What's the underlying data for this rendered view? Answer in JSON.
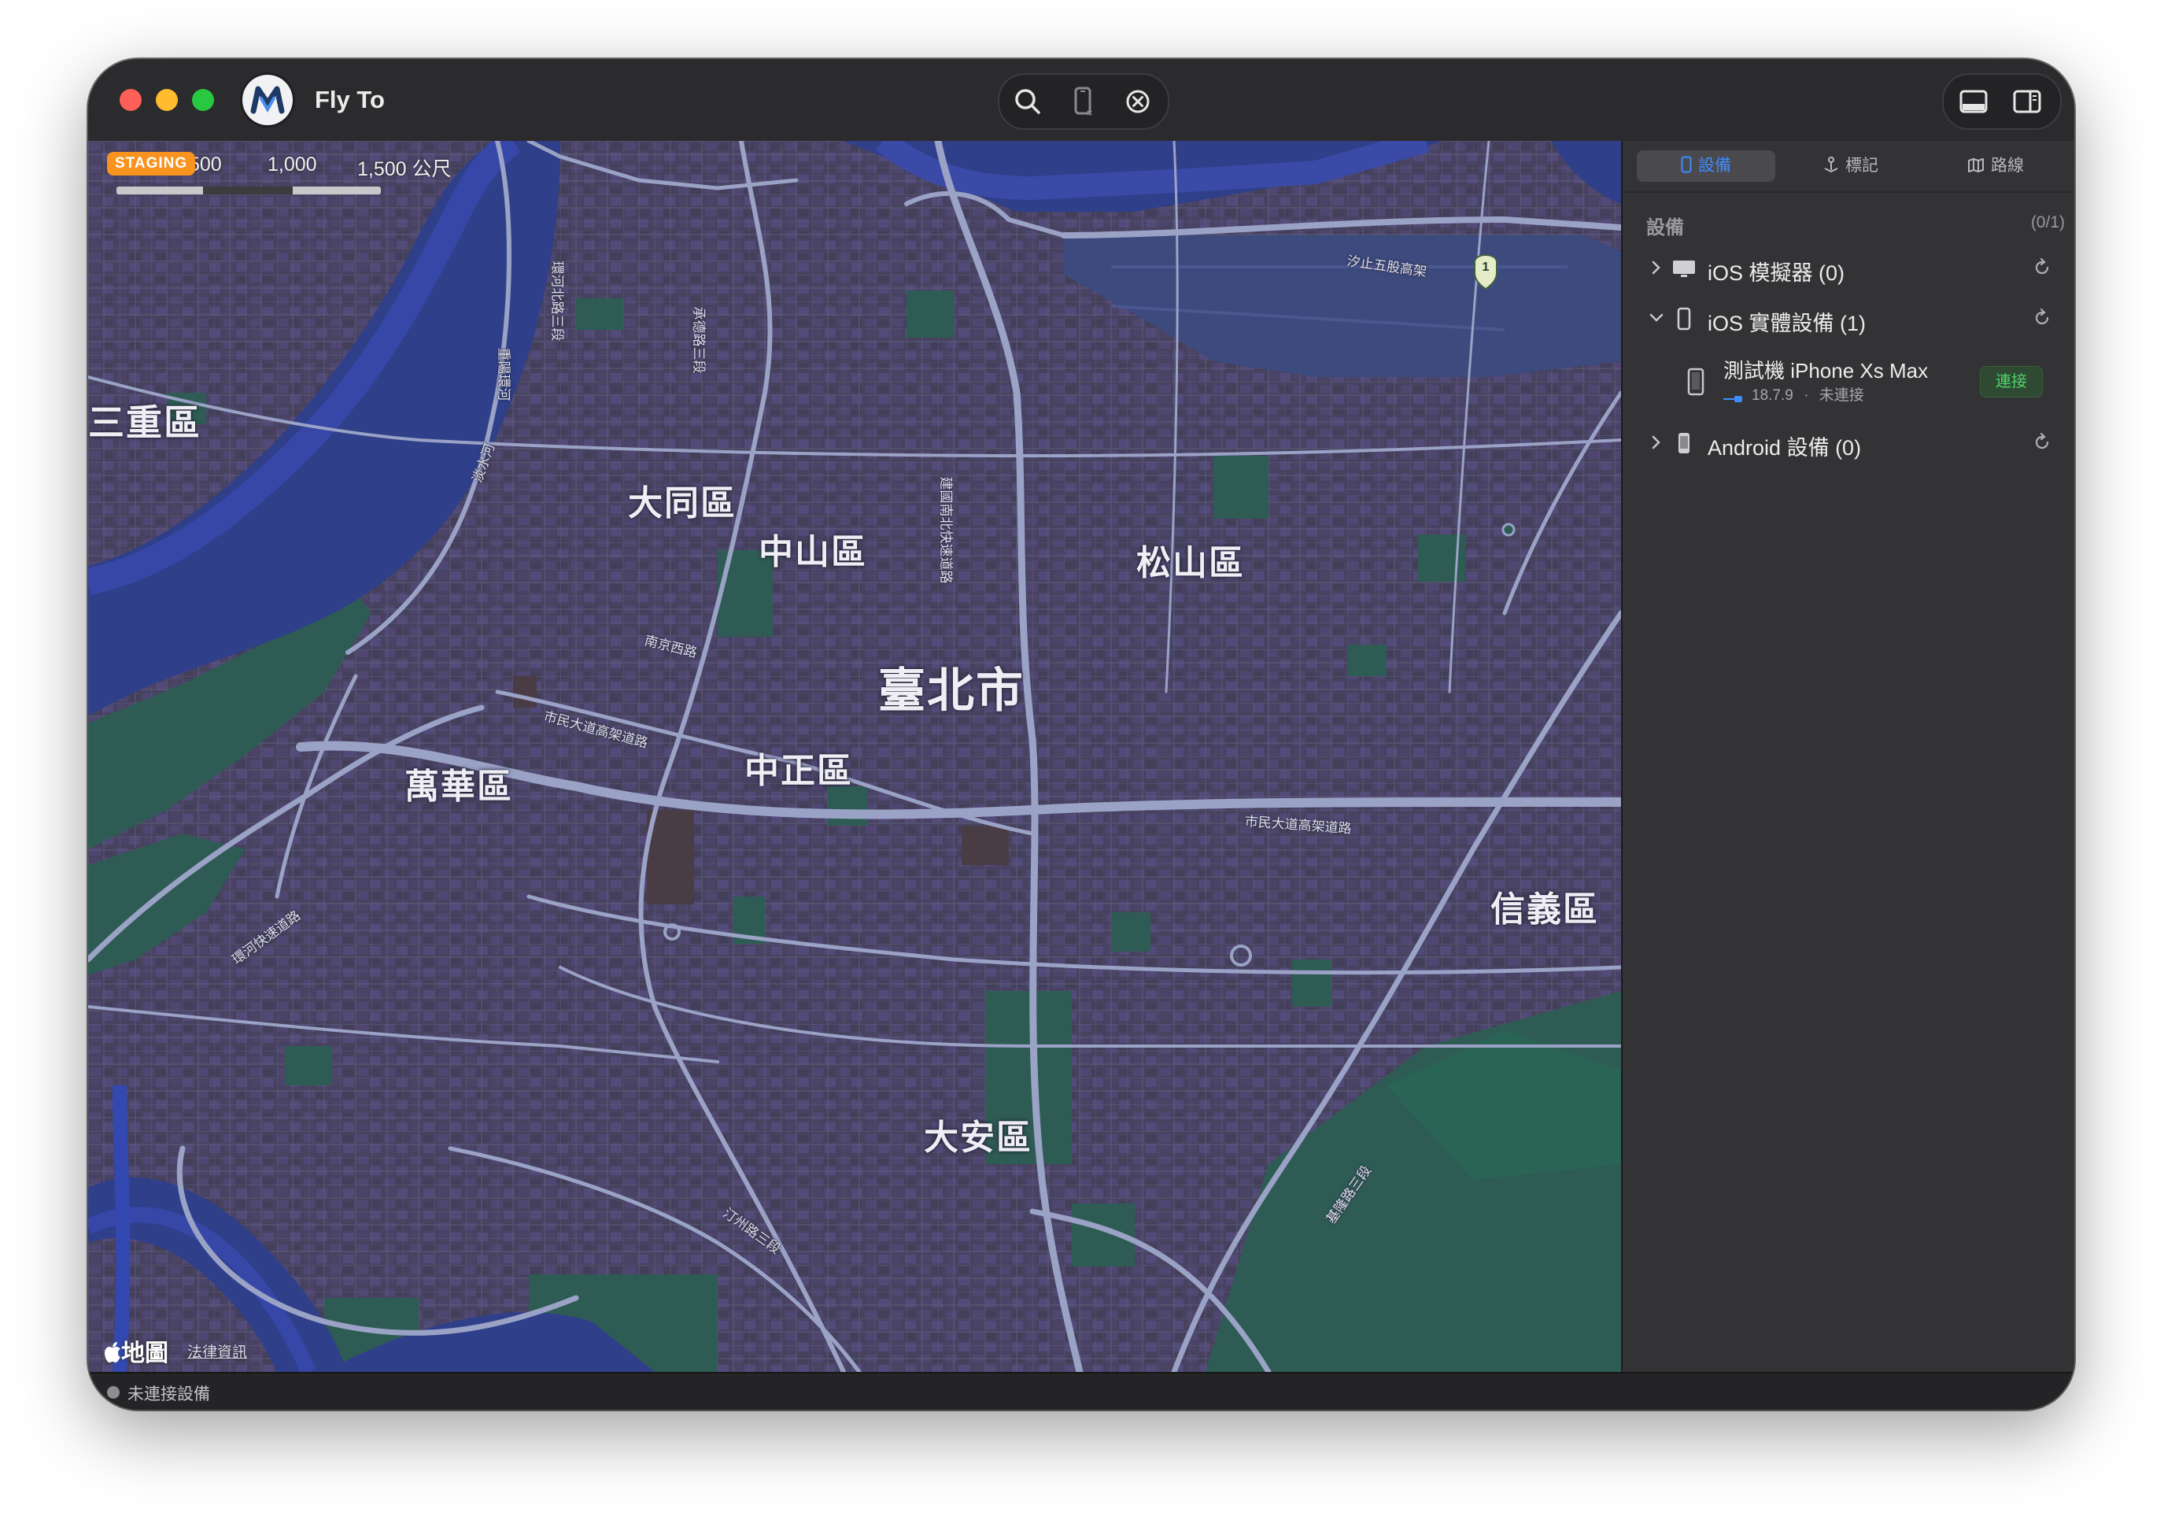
{
  "window": {
    "title": "Fly To"
  },
  "toolbar": {
    "icons": [
      "search-icon",
      "iphone-icon",
      "clear-icon",
      "bottom-panel-icon",
      "sidebar-icon"
    ]
  },
  "map": {
    "environment_badge": "STAGING",
    "scale_labels": [
      "500",
      "1,000",
      "1,500 公尺"
    ],
    "districts": [
      "三重區",
      "大同區",
      "中山區",
      "松山區",
      "臺北市",
      "萬華區",
      "中正區",
      "信義區",
      "大安區"
    ],
    "roads": [
      "汐止五股高架",
      "南京西路",
      "市民大道高架道路",
      "市民大道高架道路",
      "環河快速道路",
      "汀州路三段",
      "基隆路三段",
      "承德路三段",
      "建國南北快速道路",
      "重陽環河",
      "環河北路三段",
      "淡水河"
    ],
    "highway_shield": "1",
    "attribution": "地圖",
    "legal_link": "法律資訊",
    "colors": {
      "land": "#464260",
      "park": "#2f5a52",
      "water": "#2f3f8a",
      "road": "#9ba3c4"
    }
  },
  "sidebar": {
    "tabs": [
      {
        "label": "設備",
        "icon": "iphone-icon",
        "active": true
      },
      {
        "label": "標記",
        "icon": "pin-icon",
        "active": false
      },
      {
        "label": "路線",
        "icon": "map-icon",
        "active": false
      }
    ],
    "section_title": "設備",
    "section_count": "(0/1)",
    "groups": [
      {
        "label": "iOS 模擬器 (0)",
        "expanded": false,
        "icon": "desktop-icon"
      },
      {
        "label": "iOS 實體設備 (1)",
        "expanded": true,
        "icon": "iphone-icon"
      },
      {
        "label": "Android 設備 (0)",
        "expanded": false,
        "icon": "android-phone-icon"
      }
    ],
    "device": {
      "name": "測試機 iPhone Xs Max",
      "version": "18.7.9",
      "separator": "·",
      "state": "未連接",
      "connect_label": "連接"
    }
  },
  "status": {
    "text": "未連接設備"
  }
}
